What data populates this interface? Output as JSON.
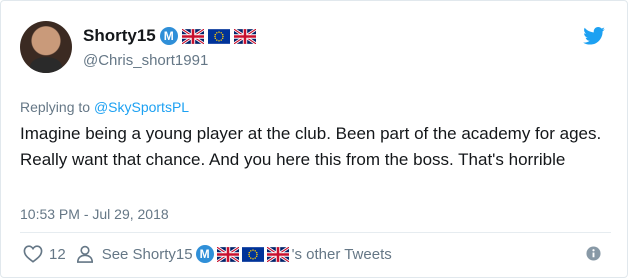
{
  "tweet": {
    "display_name": "Shorty15",
    "badge_letter": "M",
    "handle": "@Chris_short1991",
    "replying_prefix": "Replying to ",
    "replying_to": "@SkySportsPL",
    "text": "Imagine being a young player at the club. Been part of the academy for ages. Really want that chance. And you here this from the boss. That's horrible",
    "timestamp": "10:53 PM - Jul 29, 2018",
    "like_count": "12",
    "see_prefix": "See Shorty15",
    "see_suffix": "'s other Tweets"
  },
  "icons": [
    "twitter-bird-icon",
    "heart-icon",
    "person-icon",
    "info-icon",
    "uk-flag-icon",
    "eu-flag-icon"
  ],
  "colors": {
    "twitter_blue": "#1da1f2",
    "text_gray": "#657786",
    "text_dark": "#14171a",
    "badge_blue": "#2f8fd8"
  }
}
